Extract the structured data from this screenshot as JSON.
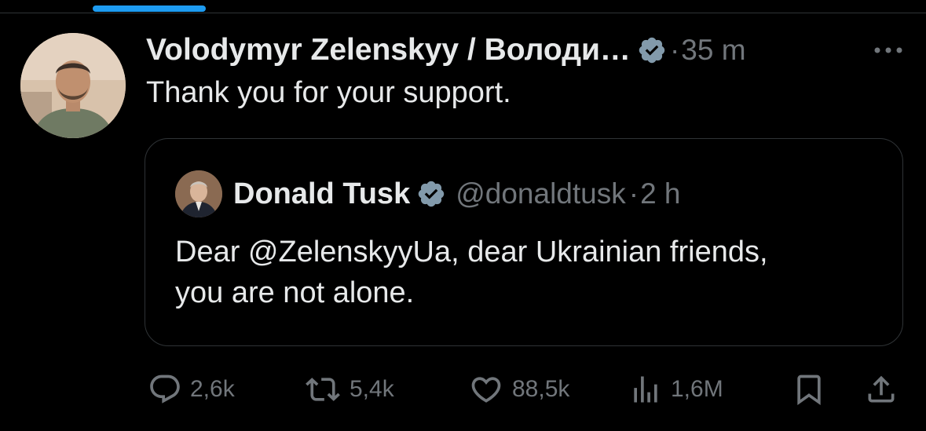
{
  "tweet": {
    "author_name": "Volodymyr Zelenskyy / Володи…",
    "dot": "·",
    "time": "35 m",
    "text": "Thank you for your support."
  },
  "quote": {
    "author_name": "Donald Tusk",
    "handle": "@donaldtusk",
    "dot": "·",
    "time": "2 h",
    "text_line1": "Dear @ZelenskyyUa, dear Ukrainian friends,",
    "text_line2": "you are not alone."
  },
  "actions": {
    "replies": "2,6k",
    "reposts": "5,4k",
    "likes": "88,5k",
    "views": "1,6M"
  },
  "colors": {
    "background": "#000000",
    "text": "#e7e9ea",
    "muted": "#71767b",
    "accent": "#1d9bf0",
    "verified_badge": "#829aab",
    "border": "#2f3336"
  },
  "icons": [
    "verified-badge-icon",
    "more-icon",
    "reply-icon",
    "repost-icon",
    "like-icon",
    "views-icon",
    "bookmark-icon",
    "share-icon"
  ]
}
